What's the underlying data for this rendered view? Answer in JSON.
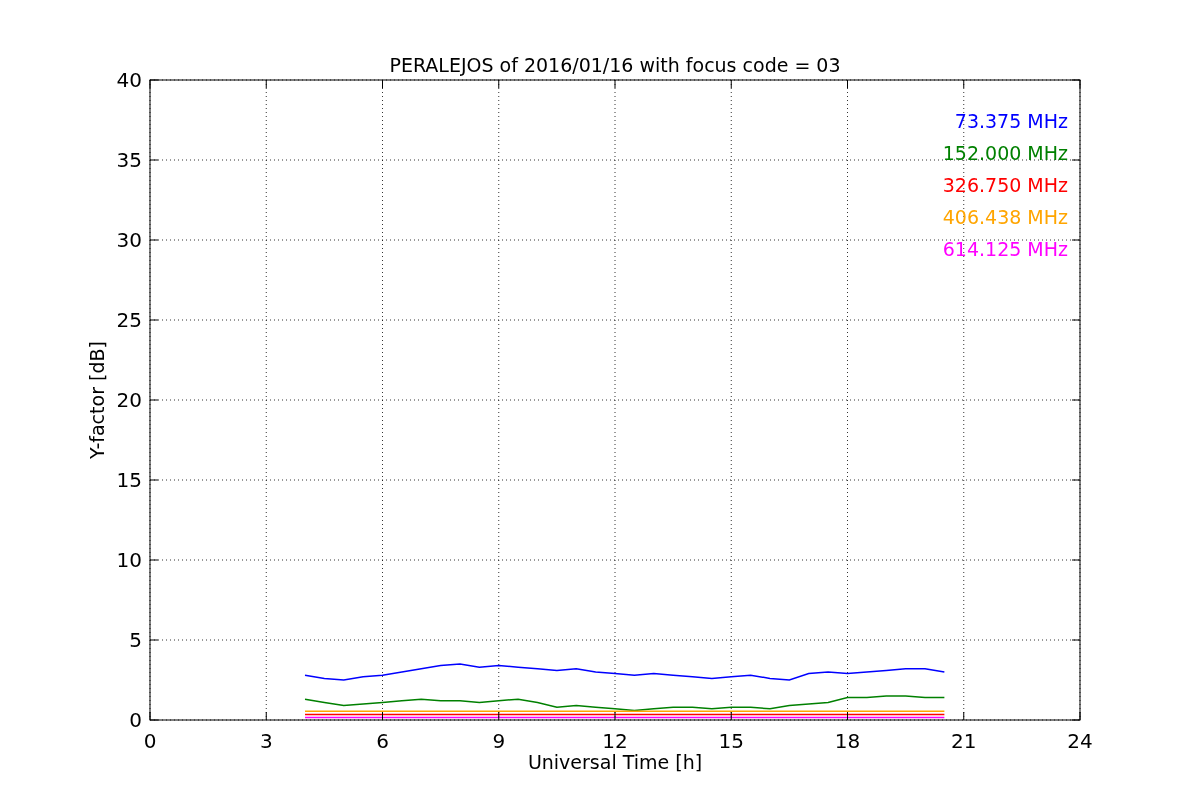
{
  "figure": {
    "chart_data": {
      "type": "line",
      "title": "PERALEJOS of 2016/01/16 with focus code = 03",
      "xlabel": "Universal Time [h]",
      "ylabel": "Y-factor [dB]",
      "x": [
        4,
        4.5,
        5,
        5.5,
        6,
        6.5,
        7,
        7.5,
        8,
        8.5,
        9,
        9.5,
        10,
        10.5,
        11,
        11.5,
        12,
        12.5,
        13,
        13.5,
        14,
        14.5,
        15,
        15.5,
        16,
        16.5,
        17,
        17.5,
        18,
        18.5,
        19,
        19.5,
        20,
        20.5
      ],
      "series": [
        {
          "name": "73.375 MHz",
          "color": "#0000ff",
          "values": [
            2.8,
            2.6,
            2.5,
            2.7,
            2.8,
            3.0,
            3.2,
            3.4,
            3.5,
            3.3,
            3.4,
            3.3,
            3.2,
            3.1,
            3.2,
            3.0,
            2.9,
            2.8,
            2.9,
            2.8,
            2.7,
            2.6,
            2.7,
            2.8,
            2.6,
            2.5,
            2.9,
            3.0,
            2.9,
            3.0,
            3.1,
            3.2,
            3.2,
            3.0
          ]
        },
        {
          "name": "152.000 MHz",
          "color": "#008000",
          "values": [
            1.3,
            1.1,
            0.9,
            1.0,
            1.1,
            1.2,
            1.3,
            1.2,
            1.2,
            1.1,
            1.2,
            1.3,
            1.1,
            0.8,
            0.9,
            0.8,
            0.7,
            0.6,
            0.7,
            0.8,
            0.8,
            0.7,
            0.8,
            0.8,
            0.7,
            0.9,
            1.0,
            1.1,
            1.4,
            1.4,
            1.5,
            1.5,
            1.4,
            1.4
          ]
        },
        {
          "name": "326.750 MHz",
          "color": "#ff0000",
          "values": [
            0.35,
            0.35,
            0.35,
            0.35,
            0.35,
            0.35,
            0.35,
            0.35,
            0.35,
            0.35,
            0.35,
            0.35,
            0.35,
            0.35,
            0.35,
            0.35,
            0.35,
            0.35,
            0.35,
            0.35,
            0.35,
            0.35,
            0.35,
            0.35,
            0.35,
            0.35,
            0.35,
            0.35,
            0.35,
            0.35,
            0.35,
            0.35,
            0.35,
            0.35
          ]
        },
        {
          "name": "406.438 MHz",
          "color": "#ffa500",
          "values": [
            0.55,
            0.55,
            0.55,
            0.55,
            0.55,
            0.55,
            0.55,
            0.55,
            0.55,
            0.55,
            0.55,
            0.55,
            0.55,
            0.55,
            0.55,
            0.55,
            0.55,
            0.55,
            0.55,
            0.55,
            0.55,
            0.55,
            0.55,
            0.55,
            0.55,
            0.55,
            0.55,
            0.55,
            0.55,
            0.55,
            0.55,
            0.55,
            0.55,
            0.55
          ]
        },
        {
          "name": "614.125 MHz",
          "color": "#ff00ff",
          "values": [
            0.15,
            0.15,
            0.15,
            0.15,
            0.15,
            0.15,
            0.15,
            0.15,
            0.15,
            0.15,
            0.15,
            0.15,
            0.15,
            0.15,
            0.15,
            0.15,
            0.15,
            0.15,
            0.15,
            0.15,
            0.15,
            0.15,
            0.15,
            0.15,
            0.15,
            0.15,
            0.15,
            0.15,
            0.15,
            0.15,
            0.15,
            0.15,
            0.15,
            0.15
          ]
        }
      ],
      "grid": true,
      "xlim": [
        0,
        24
      ],
      "ylim": [
        0,
        40
      ],
      "xticks": [
        0,
        3,
        6,
        9,
        12,
        15,
        18,
        21,
        24
      ],
      "yticks": [
        0,
        5,
        10,
        15,
        20,
        25,
        30,
        35,
        40
      ]
    }
  }
}
